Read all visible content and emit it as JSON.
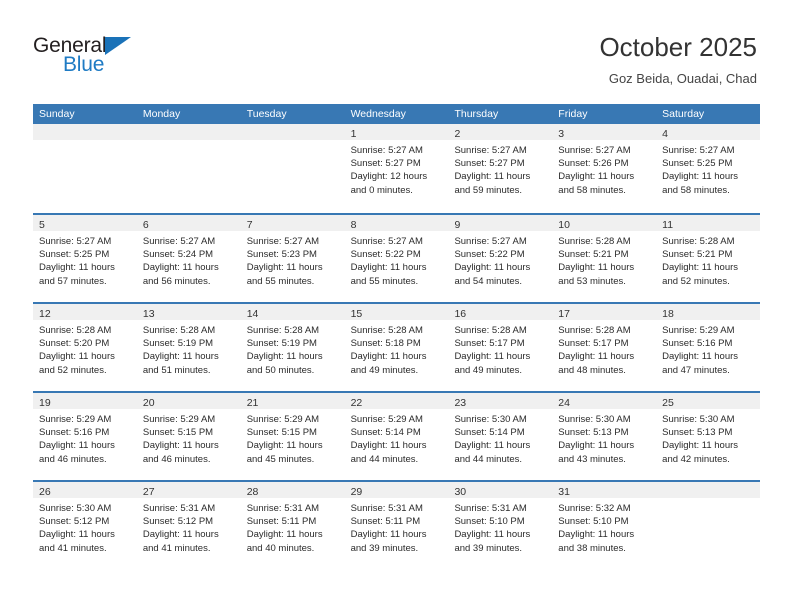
{
  "brand": {
    "name_top": "General",
    "name_bottom": "Blue",
    "accent_color": "#1a72b8"
  },
  "header": {
    "title": "October 2025",
    "subtitle": "Goz Beida, Ouadai, Chad"
  },
  "theme": {
    "header_bar": "#3878b4",
    "daynum_band": "#f0f0f0",
    "text": "#2b2b2b"
  },
  "weekdays": [
    "Sunday",
    "Monday",
    "Tuesday",
    "Wednesday",
    "Thursday",
    "Friday",
    "Saturday"
  ],
  "weeks": [
    [
      {
        "day": "",
        "lines": []
      },
      {
        "day": "",
        "lines": []
      },
      {
        "day": "",
        "lines": []
      },
      {
        "day": "1",
        "lines": [
          "Sunrise: 5:27 AM",
          "Sunset: 5:27 PM",
          "Daylight: 12 hours",
          "and 0 minutes."
        ]
      },
      {
        "day": "2",
        "lines": [
          "Sunrise: 5:27 AM",
          "Sunset: 5:27 PM",
          "Daylight: 11 hours",
          "and 59 minutes."
        ]
      },
      {
        "day": "3",
        "lines": [
          "Sunrise: 5:27 AM",
          "Sunset: 5:26 PM",
          "Daylight: 11 hours",
          "and 58 minutes."
        ]
      },
      {
        "day": "4",
        "lines": [
          "Sunrise: 5:27 AM",
          "Sunset: 5:25 PM",
          "Daylight: 11 hours",
          "and 58 minutes."
        ]
      }
    ],
    [
      {
        "day": "5",
        "lines": [
          "Sunrise: 5:27 AM",
          "Sunset: 5:25 PM",
          "Daylight: 11 hours",
          "and 57 minutes."
        ]
      },
      {
        "day": "6",
        "lines": [
          "Sunrise: 5:27 AM",
          "Sunset: 5:24 PM",
          "Daylight: 11 hours",
          "and 56 minutes."
        ]
      },
      {
        "day": "7",
        "lines": [
          "Sunrise: 5:27 AM",
          "Sunset: 5:23 PM",
          "Daylight: 11 hours",
          "and 55 minutes."
        ]
      },
      {
        "day": "8",
        "lines": [
          "Sunrise: 5:27 AM",
          "Sunset: 5:22 PM",
          "Daylight: 11 hours",
          "and 55 minutes."
        ]
      },
      {
        "day": "9",
        "lines": [
          "Sunrise: 5:27 AM",
          "Sunset: 5:22 PM",
          "Daylight: 11 hours",
          "and 54 minutes."
        ]
      },
      {
        "day": "10",
        "lines": [
          "Sunrise: 5:28 AM",
          "Sunset: 5:21 PM",
          "Daylight: 11 hours",
          "and 53 minutes."
        ]
      },
      {
        "day": "11",
        "lines": [
          "Sunrise: 5:28 AM",
          "Sunset: 5:21 PM",
          "Daylight: 11 hours",
          "and 52 minutes."
        ]
      }
    ],
    [
      {
        "day": "12",
        "lines": [
          "Sunrise: 5:28 AM",
          "Sunset: 5:20 PM",
          "Daylight: 11 hours",
          "and 52 minutes."
        ]
      },
      {
        "day": "13",
        "lines": [
          "Sunrise: 5:28 AM",
          "Sunset: 5:19 PM",
          "Daylight: 11 hours",
          "and 51 minutes."
        ]
      },
      {
        "day": "14",
        "lines": [
          "Sunrise: 5:28 AM",
          "Sunset: 5:19 PM",
          "Daylight: 11 hours",
          "and 50 minutes."
        ]
      },
      {
        "day": "15",
        "lines": [
          "Sunrise: 5:28 AM",
          "Sunset: 5:18 PM",
          "Daylight: 11 hours",
          "and 49 minutes."
        ]
      },
      {
        "day": "16",
        "lines": [
          "Sunrise: 5:28 AM",
          "Sunset: 5:17 PM",
          "Daylight: 11 hours",
          "and 49 minutes."
        ]
      },
      {
        "day": "17",
        "lines": [
          "Sunrise: 5:28 AM",
          "Sunset: 5:17 PM",
          "Daylight: 11 hours",
          "and 48 minutes."
        ]
      },
      {
        "day": "18",
        "lines": [
          "Sunrise: 5:29 AM",
          "Sunset: 5:16 PM",
          "Daylight: 11 hours",
          "and 47 minutes."
        ]
      }
    ],
    [
      {
        "day": "19",
        "lines": [
          "Sunrise: 5:29 AM",
          "Sunset: 5:16 PM",
          "Daylight: 11 hours",
          "and 46 minutes."
        ]
      },
      {
        "day": "20",
        "lines": [
          "Sunrise: 5:29 AM",
          "Sunset: 5:15 PM",
          "Daylight: 11 hours",
          "and 46 minutes."
        ]
      },
      {
        "day": "21",
        "lines": [
          "Sunrise: 5:29 AM",
          "Sunset: 5:15 PM",
          "Daylight: 11 hours",
          "and 45 minutes."
        ]
      },
      {
        "day": "22",
        "lines": [
          "Sunrise: 5:29 AM",
          "Sunset: 5:14 PM",
          "Daylight: 11 hours",
          "and 44 minutes."
        ]
      },
      {
        "day": "23",
        "lines": [
          "Sunrise: 5:30 AM",
          "Sunset: 5:14 PM",
          "Daylight: 11 hours",
          "and 44 minutes."
        ]
      },
      {
        "day": "24",
        "lines": [
          "Sunrise: 5:30 AM",
          "Sunset: 5:13 PM",
          "Daylight: 11 hours",
          "and 43 minutes."
        ]
      },
      {
        "day": "25",
        "lines": [
          "Sunrise: 5:30 AM",
          "Sunset: 5:13 PM",
          "Daylight: 11 hours",
          "and 42 minutes."
        ]
      }
    ],
    [
      {
        "day": "26",
        "lines": [
          "Sunrise: 5:30 AM",
          "Sunset: 5:12 PM",
          "Daylight: 11 hours",
          "and 41 minutes."
        ]
      },
      {
        "day": "27",
        "lines": [
          "Sunrise: 5:31 AM",
          "Sunset: 5:12 PM",
          "Daylight: 11 hours",
          "and 41 minutes."
        ]
      },
      {
        "day": "28",
        "lines": [
          "Sunrise: 5:31 AM",
          "Sunset: 5:11 PM",
          "Daylight: 11 hours",
          "and 40 minutes."
        ]
      },
      {
        "day": "29",
        "lines": [
          "Sunrise: 5:31 AM",
          "Sunset: 5:11 PM",
          "Daylight: 11 hours",
          "and 39 minutes."
        ]
      },
      {
        "day": "30",
        "lines": [
          "Sunrise: 5:31 AM",
          "Sunset: 5:10 PM",
          "Daylight: 11 hours",
          "and 39 minutes."
        ]
      },
      {
        "day": "31",
        "lines": [
          "Sunrise: 5:32 AM",
          "Sunset: 5:10 PM",
          "Daylight: 11 hours",
          "and 38 minutes."
        ]
      },
      {
        "day": "",
        "lines": []
      }
    ]
  ]
}
